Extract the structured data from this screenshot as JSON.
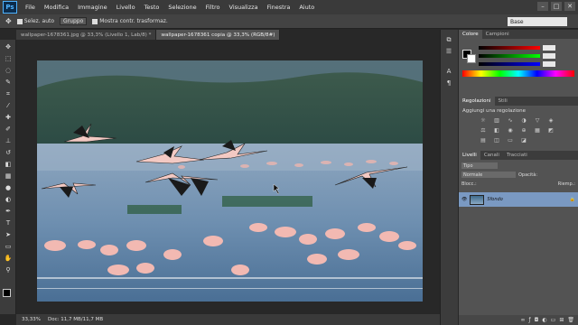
{
  "app": {
    "logo": "Ps"
  },
  "menu": [
    "File",
    "Modifica",
    "Immagine",
    "Livello",
    "Testo",
    "Selezione",
    "Filtro",
    "Visualizza",
    "Finestra",
    "Aiuto"
  ],
  "window_controls": [
    "–",
    "□",
    "✕"
  ],
  "options": {
    "select_auto": "Selez. auto",
    "group": "Gruppo",
    "transform": "Mostra contr. trasformaz."
  },
  "workspace": "Base",
  "tabs": [
    {
      "label": "wallpaper-1678361.jpg @ 33,3% (Livello 1, Lab/8) *",
      "active": false
    },
    {
      "label": "wallpaper-1678361 copia @ 33,3% (RGB/8#)",
      "active": true
    }
  ],
  "status": {
    "zoom": "33,33%",
    "doc": "Doc: 11,7 MB/11,7 MB"
  },
  "panels": {
    "color_tabs": [
      "Colore",
      "Campioni"
    ],
    "adjust_tabs": [
      "Regolazioni",
      "Stili"
    ],
    "adjust_title": "Aggiungi una regolazione",
    "layers_tabs": [
      "Livelli",
      "Canali",
      "Tracciati"
    ],
    "kind": "Tipo",
    "blend": "Normale",
    "opacity_label": "Opacità:",
    "lock_label": "Blocc.:",
    "fill_label": "Riemp.:",
    "layer_name": "Sfondo"
  },
  "colors": {
    "accent": "#7a99c2",
    "panel": "#535353"
  }
}
